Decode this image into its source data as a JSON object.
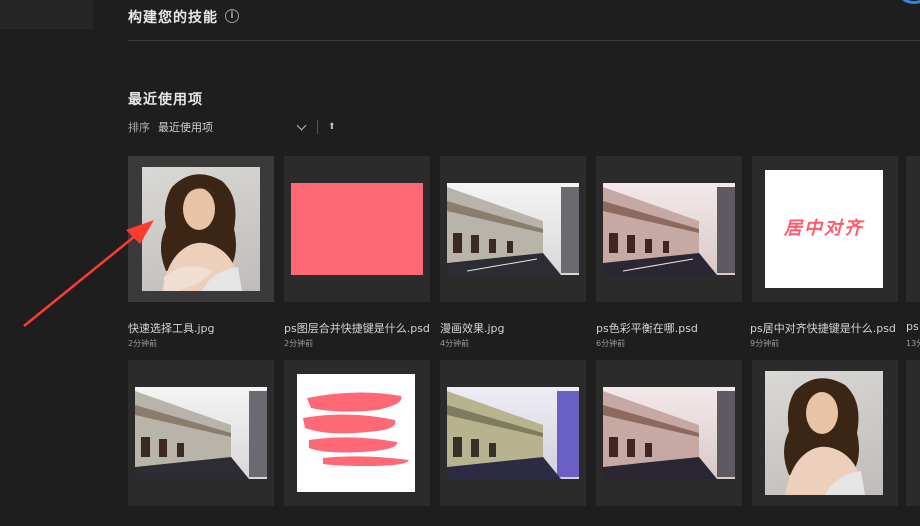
{
  "header": {
    "skills_title": "构建您的技能",
    "info_icon": "i"
  },
  "recent": {
    "title": "最近使用项",
    "sort_label": "排序",
    "sort_value": "最近使用项",
    "sort_arrow": "⬆"
  },
  "files_row1": [
    {
      "name": "快速选择工具.jpg",
      "time": "2分钟前",
      "thumb": "woman-photo"
    },
    {
      "name": "ps图层合并快捷键是什么.psd",
      "time": "2分钟前",
      "thumb": "pink-rectangle"
    },
    {
      "name": "漫画效果.jpg",
      "time": "4分钟前",
      "thumb": "street-photo"
    },
    {
      "name": "ps色彩平衡在哪.psd",
      "time": "6分钟前",
      "thumb": "street-photo-warm"
    },
    {
      "name": "ps居中对齐快捷键是什么.psd",
      "time": "9分钟前",
      "thumb": "centered-text",
      "thumb_text": "居中对齐"
    },
    {
      "name": "ps",
      "time": "13分",
      "thumb": "partial"
    }
  ],
  "files_row2": [
    {
      "thumb": "street-photo"
    },
    {
      "thumb": "pink-brush-strokes"
    },
    {
      "thumb": "street-photo-purple"
    },
    {
      "thumb": "street-photo-warm"
    },
    {
      "thumb": "woman-photo"
    },
    {
      "thumb": "partial"
    }
  ],
  "colors": {
    "background": "#1e1e1e",
    "card": "#2b2b2b",
    "pink": "#ff6975",
    "annotation_arrow": "#ff3b30"
  }
}
